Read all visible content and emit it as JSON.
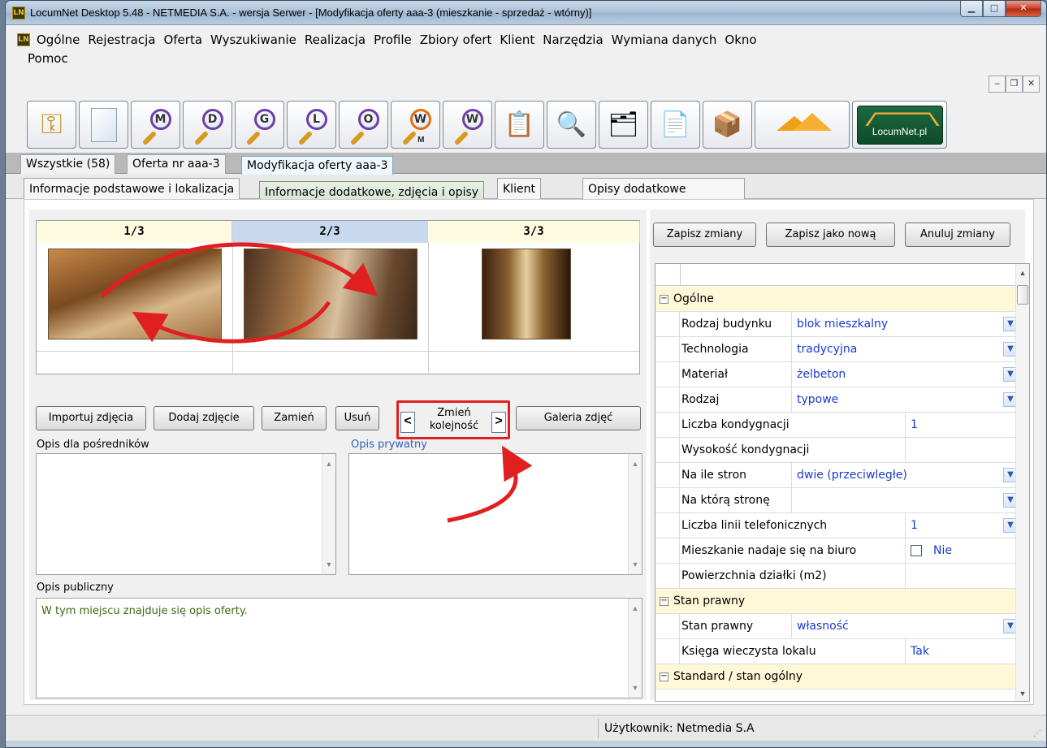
{
  "window": {
    "title": "LocumNet Desktop 5.48 - NETMEDIA S.A. - wersja Serwer - [Modyfikacja oferty aaa-3 (mieszkanie - sprzedaż - wtórny)]",
    "app_icon_letters": "LN"
  },
  "menu": {
    "items": [
      "Ogólne",
      "Rejestracja",
      "Oferta",
      "Wyszukiwanie",
      "Realizacja",
      "Profile",
      "Zbiory ofert",
      "Klient",
      "Narzędzia",
      "Wymiana danych",
      "Okno"
    ],
    "row2": "Pomoc"
  },
  "toolbar": {
    "search_letters": [
      "M",
      "D",
      "G",
      "L",
      "O",
      "W",
      "W"
    ],
    "search_sub": "M",
    "logo_text": "LocumNet.pl"
  },
  "doc_tabs": [
    "Wszystkie (58)",
    "Oferta nr aaa-3",
    "Modyfikacja oferty aaa-3"
  ],
  "section_tabs": [
    "Informacje podstawowe i lokalizacja",
    "Informacje dodatkowe, zdjęcia i opisy",
    "Klient",
    "Opisy dodatkowe"
  ],
  "photos": {
    "headers": [
      "1/3",
      "2/3",
      "3/3"
    ],
    "selected_index": 1
  },
  "photo_buttons": {
    "import": "Importuj zdjęcia",
    "add": "Dodaj zdjęcie",
    "replace": "Zamień",
    "delete": "Usuń",
    "change_order_1": "Zmień",
    "change_order_2": "kolejność",
    "prev": "<",
    "next": ">",
    "gallery": "Galeria zdjęć"
  },
  "descriptions": {
    "agents_label": "Opis dla pośredników",
    "private_label": "Opis prywatny",
    "public_label": "Opis publiczny",
    "public_text": "W tym miejscu znajduje się opis oferty."
  },
  "actions": {
    "save": "Zapisz zmiany",
    "save_new": "Zapisz jako nową",
    "cancel": "Anuluj zmiany"
  },
  "properties": {
    "rows": [
      {
        "kind": "cat",
        "name": "Ogólne"
      },
      {
        "kind": "prop",
        "name": "Rodzaj budynku",
        "value": "blok mieszkalny",
        "dropdown": true,
        "split": "short"
      },
      {
        "kind": "prop",
        "name": "Technologia",
        "value": "tradycyjna",
        "dropdown": true,
        "split": "short"
      },
      {
        "kind": "prop",
        "name": "Materiał",
        "value": "żelbeton",
        "dropdown": true,
        "split": "short"
      },
      {
        "kind": "prop",
        "name": "Rodzaj",
        "value": "typowe",
        "dropdown": true,
        "split": "short"
      },
      {
        "kind": "prop",
        "name": "Liczba kondygnacji",
        "value": "1",
        "dropdown": false,
        "split": "long"
      },
      {
        "kind": "prop",
        "name": "Wysokość kondygnacji",
        "value": "",
        "dropdown": false,
        "split": "long"
      },
      {
        "kind": "prop",
        "name": "Na ile stron",
        "value": "dwie (przeciwległe)",
        "dropdown": true,
        "split": "short"
      },
      {
        "kind": "prop",
        "name": "Na którą stronę",
        "value": "",
        "dropdown": true,
        "split": "short"
      },
      {
        "kind": "prop",
        "name": "Liczba linii telefonicznych",
        "value": "1",
        "dropdown": true,
        "split": "long"
      },
      {
        "kind": "prop",
        "name": "Mieszkanie nadaje się na biuro",
        "value": "Nie",
        "checkbox": true,
        "split": "long"
      },
      {
        "kind": "prop",
        "name": "Powierzchnia działki (m2)",
        "value": "",
        "dropdown": false,
        "split": "long"
      },
      {
        "kind": "cat",
        "name": "Stan prawny"
      },
      {
        "kind": "prop",
        "name": "Stan prawny",
        "value": "własność",
        "dropdown": true,
        "split": "short"
      },
      {
        "kind": "prop",
        "name": "Księga wieczysta lokalu",
        "value": "Tak",
        "dropdown": false,
        "split": "long"
      },
      {
        "kind": "cat",
        "name": "Standard / stan ogólny"
      }
    ]
  },
  "status": {
    "user": "Użytkownik: Netmedia S.A"
  },
  "colors": {
    "annotation_arrow": "#e02020",
    "value_text": "#1a3ad0",
    "category_bg": "#fff8d8",
    "public_text": "#3a6a10"
  }
}
